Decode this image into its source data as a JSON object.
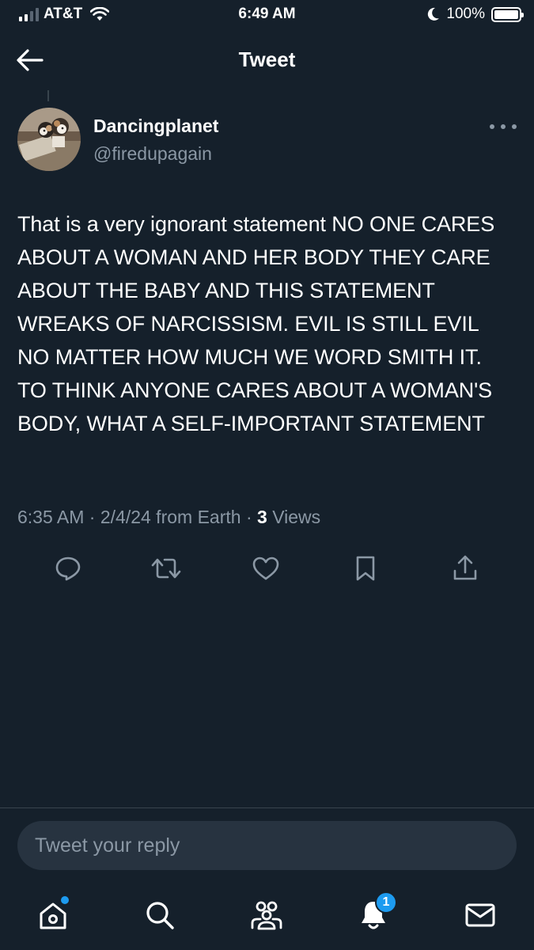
{
  "status_bar": {
    "carrier": "AT&T",
    "time": "6:49 AM",
    "battery_percent": "100%",
    "signal_bars": 2,
    "do_not_disturb": true
  },
  "header": {
    "title": "Tweet",
    "back_icon": "arrow-left-icon"
  },
  "tweet": {
    "author": {
      "display_name": "Dancingplanet",
      "handle": "@firedupagain"
    },
    "text": "That is a very ignorant statement NO ONE CARES ABOUT A WOMAN AND HER BODY THEY CARE ABOUT THE BABY AND THIS STATEMENT WREAKS OF NARCISSISM. EVIL IS STILL EVIL NO MATTER HOW MUCH WE WORD SMITH IT. TO THINK ANYONE CARES ABOUT A WOMAN'S BODY, WHAT A SELF-IMPORTANT STATEMENT",
    "meta": {
      "time": "6:35 AM",
      "sep1": " · ",
      "date": "2/4/24",
      "source": " from Earth",
      "sep2": " · ",
      "views_count": "3",
      "views_label": " Views"
    },
    "actions": [
      "reply-icon",
      "retweet-icon",
      "like-icon",
      "bookmark-icon",
      "share-icon"
    ]
  },
  "reply": {
    "placeholder": "Tweet your reply"
  },
  "tabbar": {
    "items": [
      "home-icon",
      "search-icon",
      "communities-icon",
      "notifications-icon",
      "messages-icon"
    ],
    "notifications_badge": "1"
  },
  "colors": {
    "background": "#15202b",
    "text_primary": "#ffffff",
    "text_secondary": "#8b98a5",
    "accent": "#1d9bf0",
    "divider": "#38444d"
  }
}
